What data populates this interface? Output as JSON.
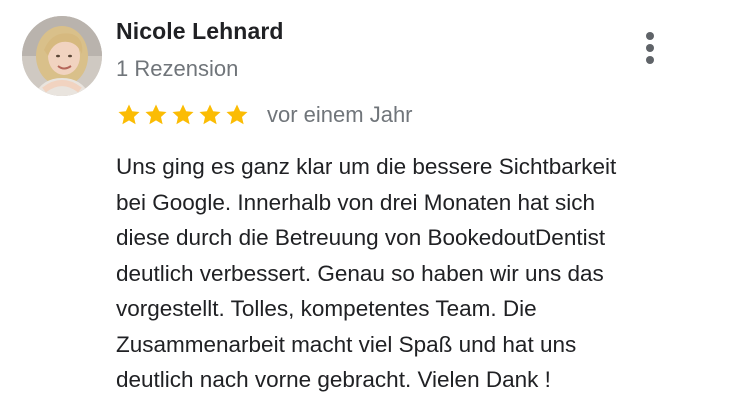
{
  "reviewer": {
    "name": "Nicole Lehnard",
    "review_count": "1 Rezension",
    "avatar_icon": "profile-photo-avatar"
  },
  "rating": {
    "stars": 5,
    "max_stars": 5,
    "star_color": "#fbbc04",
    "time_ago": "vor einem Jahr"
  },
  "menu": {
    "icon": "more-vert-icon"
  },
  "review": {
    "lines": [
      "Uns ging es ganz klar um die bessere Sichtbarkeit",
      "bei Google. Innerhalb von drei Monaten hat sich",
      "diese durch die Betreuung von BookedoutDentist",
      "deutlich verbessert. Genau so haben wir uns das",
      "vorgestellt. Tolles, kompetentes Team. Die",
      "Zusammenarbeit macht viel Spaß und hat uns",
      "deutlich nach vorne gebracht. Vielen Dank !"
    ]
  }
}
